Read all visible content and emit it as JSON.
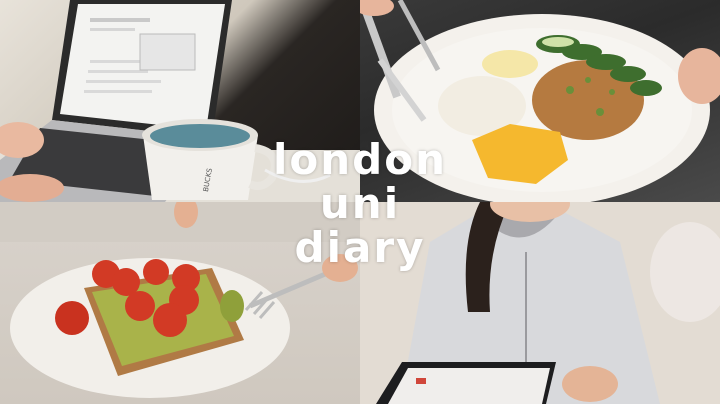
{
  "title": {
    "line1": "london",
    "line2": "uni",
    "line3": "diary"
  },
  "mug_logo_text": "BUCKS",
  "colors": {
    "title_text": "#ffffff",
    "plate": "#f4f1ec",
    "rice": "#f2ede2",
    "mango": "#f5b82e",
    "cucumber": "#3e6e2e",
    "tomato": "#d23a25",
    "avocado": "#a9b34a",
    "toast": "#b07a45"
  }
}
